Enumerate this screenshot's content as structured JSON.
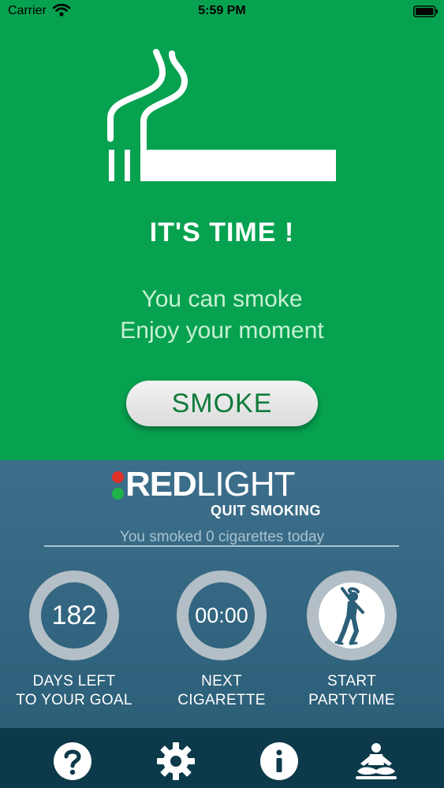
{
  "status_bar": {
    "carrier": "Carrier",
    "time": "5:59 PM"
  },
  "main": {
    "headline": "IT'S TIME !",
    "line1": "You can smoke",
    "line2": "Enjoy your moment",
    "button_label": "SMOKE"
  },
  "logo": {
    "word_bold": "RED",
    "word_light": "LIGHT",
    "tagline": "QUIT SMOKING",
    "dot_colors": [
      "#e0302a",
      "#20b24a"
    ]
  },
  "stats": {
    "smoked_today": "You smoked 0 cigarettes today",
    "days_left_value": "182",
    "days_left_label_1": "DAYS LEFT",
    "days_left_label_2": "TO YOUR GOAL",
    "next_value": "00:00",
    "next_label_1": "NEXT",
    "next_label_2": "CIGARETTE",
    "party_label_1": "START",
    "party_label_2": "PARTYTIME"
  },
  "tabs": [
    {
      "icon": "help-icon"
    },
    {
      "icon": "gear-icon"
    },
    {
      "icon": "info-icon"
    },
    {
      "icon": "meditation-icon"
    }
  ],
  "colors": {
    "green_background": "#07a250",
    "blue_background": "#3d6f8c",
    "tab_bar": "#0c3a4a",
    "ring": "#b3bec6"
  }
}
